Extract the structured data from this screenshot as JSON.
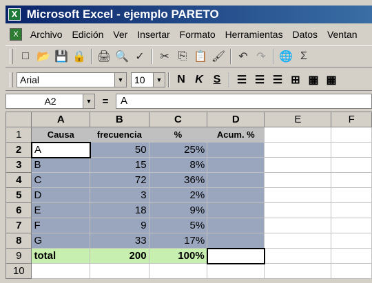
{
  "window": {
    "title": "Microsoft Excel - ejemplo PARETO"
  },
  "menu": {
    "items": [
      "Archivo",
      "Edición",
      "Ver",
      "Insertar",
      "Formato",
      "Herramientas",
      "Datos",
      "Ventan"
    ]
  },
  "format_toolbar": {
    "font": "Arial",
    "size": "10",
    "bold": "N",
    "italic": "K",
    "underline": "S"
  },
  "formula_bar": {
    "cell_ref": "A2",
    "equals": "=",
    "content": "A"
  },
  "columns": [
    "A",
    "B",
    "C",
    "D",
    "E",
    "F"
  ],
  "row_numbers": [
    "1",
    "2",
    "3",
    "4",
    "5",
    "6",
    "7",
    "8",
    "9",
    "10"
  ],
  "sheet": {
    "header": [
      "Causa",
      "frecuencia",
      "%",
      "Acum. %"
    ],
    "rows": [
      [
        "A",
        "50",
        "25%",
        ""
      ],
      [
        "B",
        "15",
        "8%",
        ""
      ],
      [
        "C",
        "72",
        "36%",
        ""
      ],
      [
        "D",
        "3",
        "2%",
        ""
      ],
      [
        "E",
        "18",
        "9%",
        ""
      ],
      [
        "F",
        "9",
        "5%",
        ""
      ],
      [
        "G",
        "33",
        "17%",
        ""
      ]
    ],
    "total": [
      "total",
      "200",
      "100%",
      ""
    ]
  },
  "colors": {
    "selection": "#9aa6bd",
    "total_row": "#c6efb0",
    "title_bar": "#0a246a"
  }
}
